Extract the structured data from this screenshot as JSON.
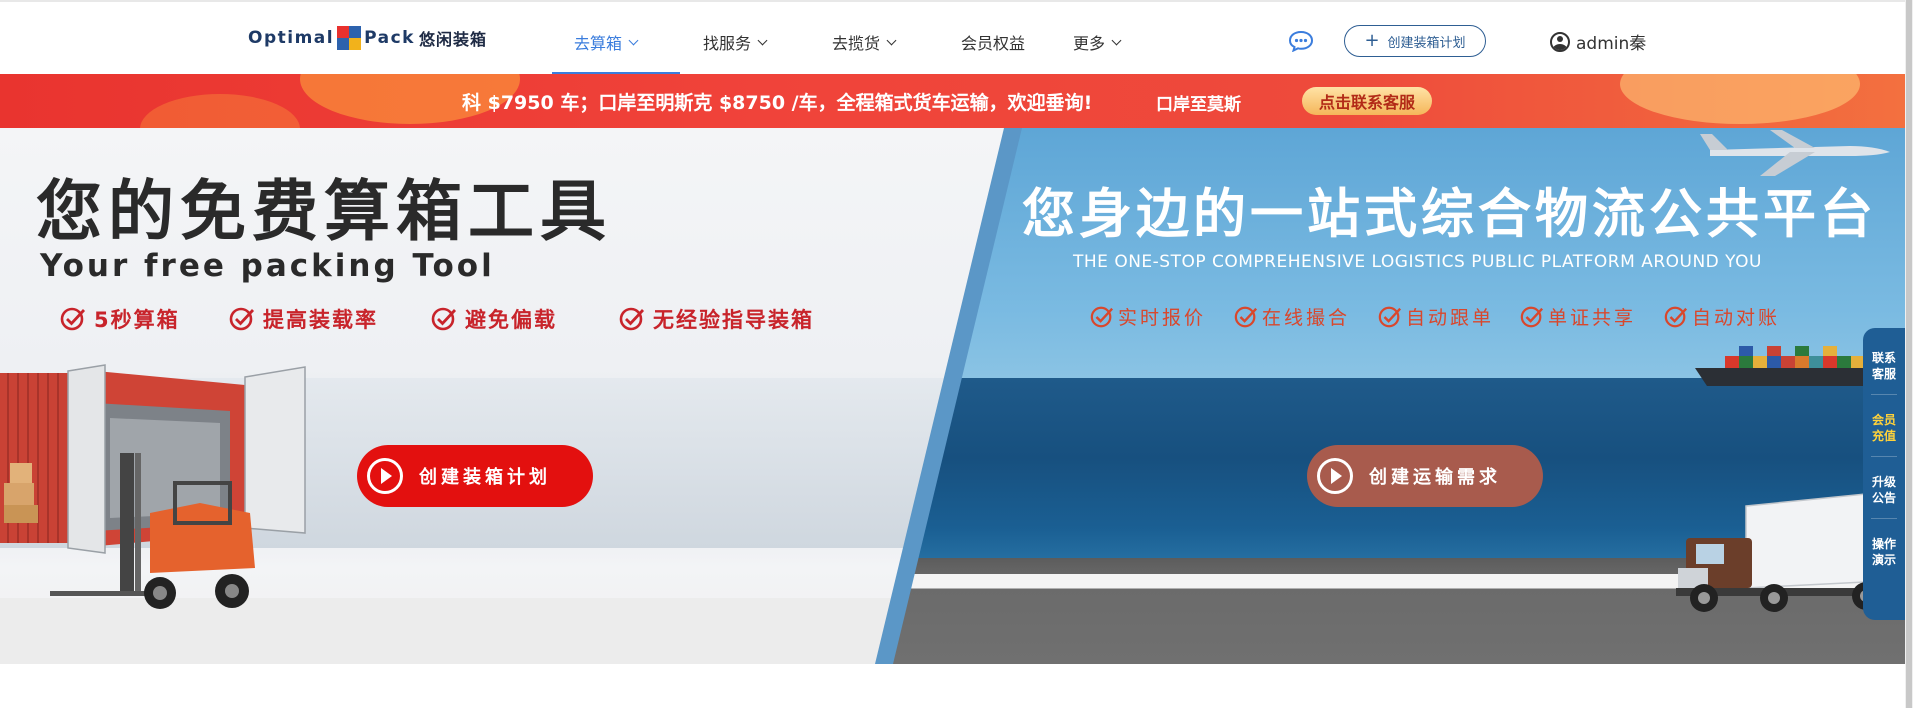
{
  "nav": {
    "logo": {
      "word1": "Optimal",
      "word2": "Pack",
      "cn": "悠闲装箱"
    },
    "items": [
      {
        "label": "去算箱",
        "active": true,
        "dropdown": true
      },
      {
        "label": "找服务",
        "active": false,
        "dropdown": true
      },
      {
        "label": "去揽货",
        "active": false,
        "dropdown": true
      },
      {
        "label": "会员权益",
        "active": false,
        "dropdown": false
      },
      {
        "label": "更多",
        "active": false,
        "dropdown": true
      }
    ],
    "create_plan_label": "创建装箱计划",
    "username": "admin秦"
  },
  "promo": {
    "text": "科 $7950 车；口岸至明斯克 $8750 /车，全程箱式货车运输，欢迎垂询!",
    "text2": "口岸至莫斯",
    "button": "点击联系客服"
  },
  "hero_left": {
    "title": "您的免费算箱工具",
    "subtitle": "Your free packing Tool",
    "features": [
      "5秒算箱",
      "提高装载率",
      "避免偏载",
      "无经验指导装箱"
    ],
    "button": "创建装箱计划"
  },
  "hero_right": {
    "title": "您身边的一站式综合物流公共平台",
    "subtitle": "THE ONE-STOP COMPREHENSIVE LOGISTICS PUBLIC PLATFORM AROUND YOU",
    "features": [
      "实时报价",
      "在线撮合",
      "自动跟单",
      "单证共享",
      "自动对账"
    ],
    "button": "创建运输需求"
  },
  "side_dock": {
    "items": [
      {
        "label": "联系\n客服",
        "highlight": false
      },
      {
        "label": "会员\n充值",
        "highlight": true
      },
      {
        "label": "升级\n公告",
        "highlight": false
      },
      {
        "label": "操作\n演示",
        "highlight": false
      }
    ]
  },
  "colors": {
    "accent": "#3b7ddd",
    "promo_red": "#ee4a3b",
    "cta_red": "#e3100f",
    "cta_brown": "#a85b4d",
    "dock_blue": "#1f5e95"
  }
}
